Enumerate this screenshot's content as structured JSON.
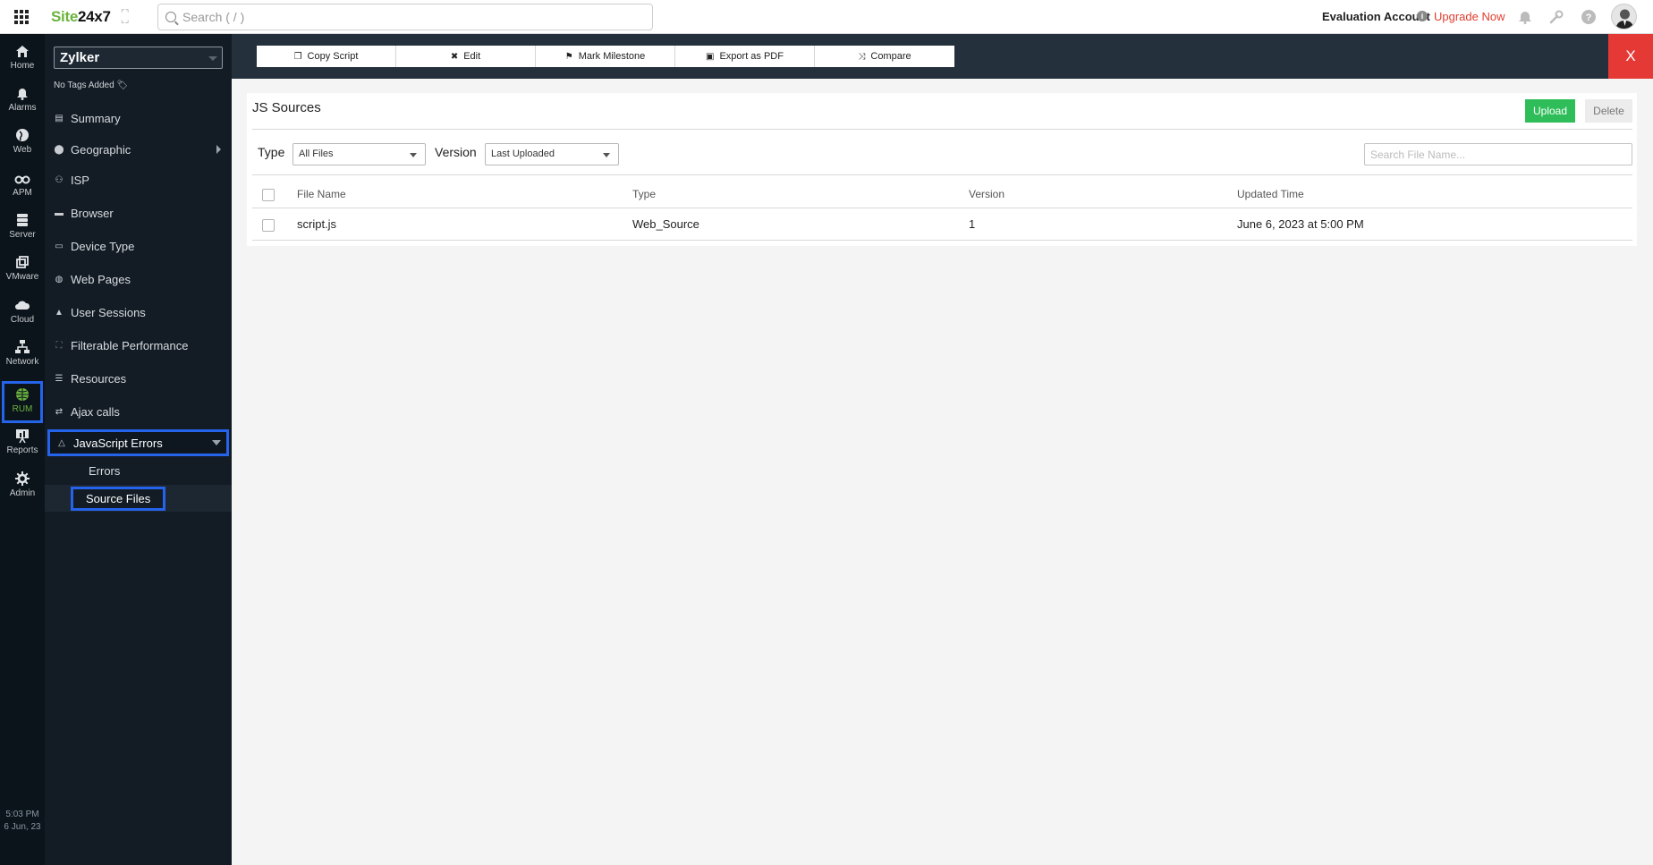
{
  "header": {
    "logo_green": "Site",
    "logo_dark": "24x7",
    "search_placeholder": "Search ( / )",
    "account_label": "Evaluation Account",
    "upgrade_label": "Upgrade Now"
  },
  "rail": {
    "items": [
      {
        "label": "Home",
        "icon": "home-icon"
      },
      {
        "label": "Alarms",
        "icon": "bell-icon"
      },
      {
        "label": "Web",
        "icon": "globe-icon"
      },
      {
        "label": "APM",
        "icon": "binoculars-icon"
      },
      {
        "label": "Server",
        "icon": "server-icon"
      },
      {
        "label": "VMware",
        "icon": "vmware-icon"
      },
      {
        "label": "Cloud",
        "icon": "cloud-icon"
      },
      {
        "label": "Network",
        "icon": "network-icon"
      },
      {
        "label": "RUM",
        "icon": "rum-globe-icon",
        "active": true
      },
      {
        "label": "Reports",
        "icon": "reports-icon"
      },
      {
        "label": "Admin",
        "icon": "gear-icon"
      }
    ],
    "time": "5:03 PM",
    "date": "6 Jun, 23"
  },
  "sidebar": {
    "monitor": "Zylker",
    "tags": "No Tags Added",
    "items": [
      {
        "label": "Summary",
        "icon": "document-icon"
      },
      {
        "label": "Geographic",
        "icon": "location-pin-icon"
      },
      {
        "label": "ISP",
        "icon": "isp-icon"
      },
      {
        "label": "Browser",
        "icon": "browser-icon"
      },
      {
        "label": "Device Type",
        "icon": "monitor-icon"
      },
      {
        "label": "Web Pages",
        "icon": "web-pages-icon"
      },
      {
        "label": "User Sessions",
        "icon": "user-icon"
      },
      {
        "label": "Filterable Performance",
        "icon": "chart-icon"
      },
      {
        "label": "Resources",
        "icon": "database-icon"
      },
      {
        "label": "Ajax calls",
        "icon": "refresh-icon"
      },
      {
        "label": "JavaScript Errors",
        "icon": "warning-icon"
      }
    ],
    "sub_items": [
      {
        "label": "Errors"
      },
      {
        "label": "Source Files",
        "selected": true
      }
    ]
  },
  "toolbar": {
    "buttons": [
      {
        "label": "Copy Script",
        "icon": "copy-icon"
      },
      {
        "label": "Edit",
        "icon": "edit-icon"
      },
      {
        "label": "Mark Milestone",
        "icon": "flag-icon"
      },
      {
        "label": "Export as PDF",
        "icon": "pdf-icon"
      },
      {
        "label": "Compare",
        "icon": "shuffle-icon"
      }
    ],
    "close_label": "X"
  },
  "main": {
    "title": "JS Sources",
    "upload_label": "Upload",
    "delete_label": "Delete",
    "type_label": "Type",
    "type_value": "All Files",
    "version_label": "Version",
    "version_value": "Last Uploaded",
    "file_search_placeholder": "Search File Name...",
    "columns": [
      "File Name",
      "Type",
      "Version",
      "Updated Time"
    ],
    "rows": [
      {
        "file_name": "script.js",
        "type": "Web_Source",
        "version": "1",
        "updated": "June 6, 2023 at 5:00 PM"
      }
    ]
  },
  "colors": {
    "brand_green": "#6cb33f",
    "upgrade_red": "#e03e2f",
    "close_red": "#e53935",
    "upload_green": "#2ebd59",
    "highlight_blue": "#2563eb"
  }
}
